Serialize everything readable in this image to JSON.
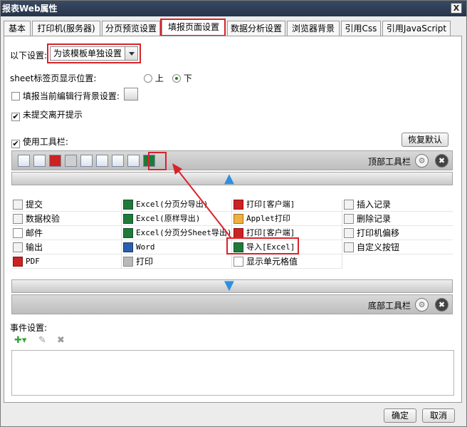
{
  "window": {
    "title": "报表Web属性",
    "close_label": "X"
  },
  "tabs": [
    {
      "label": "基本"
    },
    {
      "label": "打印机(服务器)"
    },
    {
      "label": "分页预览设置"
    },
    {
      "label": "填报页面设置"
    },
    {
      "label": "数据分析设置"
    },
    {
      "label": "浏览器背景"
    },
    {
      "label": "引用Css"
    },
    {
      "label": "引用JavaScript"
    }
  ],
  "settings": {
    "label": "以下设置:",
    "select_value": "为该模板单独设置",
    "sheet_pos_label": "sheet标签页显示位置:",
    "radio_top": "上",
    "radio_bottom": "下",
    "fill_bg_label": "填报当前编辑行背景设置:",
    "unsubmitted_label": "未提交离开提示",
    "unsubmitted_check": "✔",
    "use_toolbar_label": "使用工具栏:",
    "use_toolbar_check": "✔",
    "restore_default": "恢复默认"
  },
  "toolbar": {
    "top_label": "顶部工具栏",
    "bottom_label": "底部工具栏",
    "up_arrow": "▲",
    "down_arrow": "▼",
    "gear": "⚙",
    "close": "✖"
  },
  "buttons": {
    "col1": [
      "提交",
      "数据校验",
      "邮件",
      "输出",
      "PDF"
    ],
    "col2": [
      "Excel(分页分导出)",
      "Excel(原样导出)",
      "Excel(分页分Sheet导出)",
      "Word",
      "打印"
    ],
    "col3": [
      "打印[客户端]",
      "Applet打印",
      "打印[客户端]",
      "导入[Excel]",
      "显示单元格值"
    ],
    "col4": [
      "插入记录",
      "删除记录",
      "打印机偏移",
      "自定义按钮"
    ]
  },
  "events": {
    "label": "事件设置:",
    "add": "✚▾",
    "edit": "✎",
    "delete": "✖"
  },
  "footer": {
    "ok": "确定",
    "cancel": "取消"
  },
  "colors": {
    "highlight": "#d8232a",
    "title_bar": "#26344b"
  }
}
